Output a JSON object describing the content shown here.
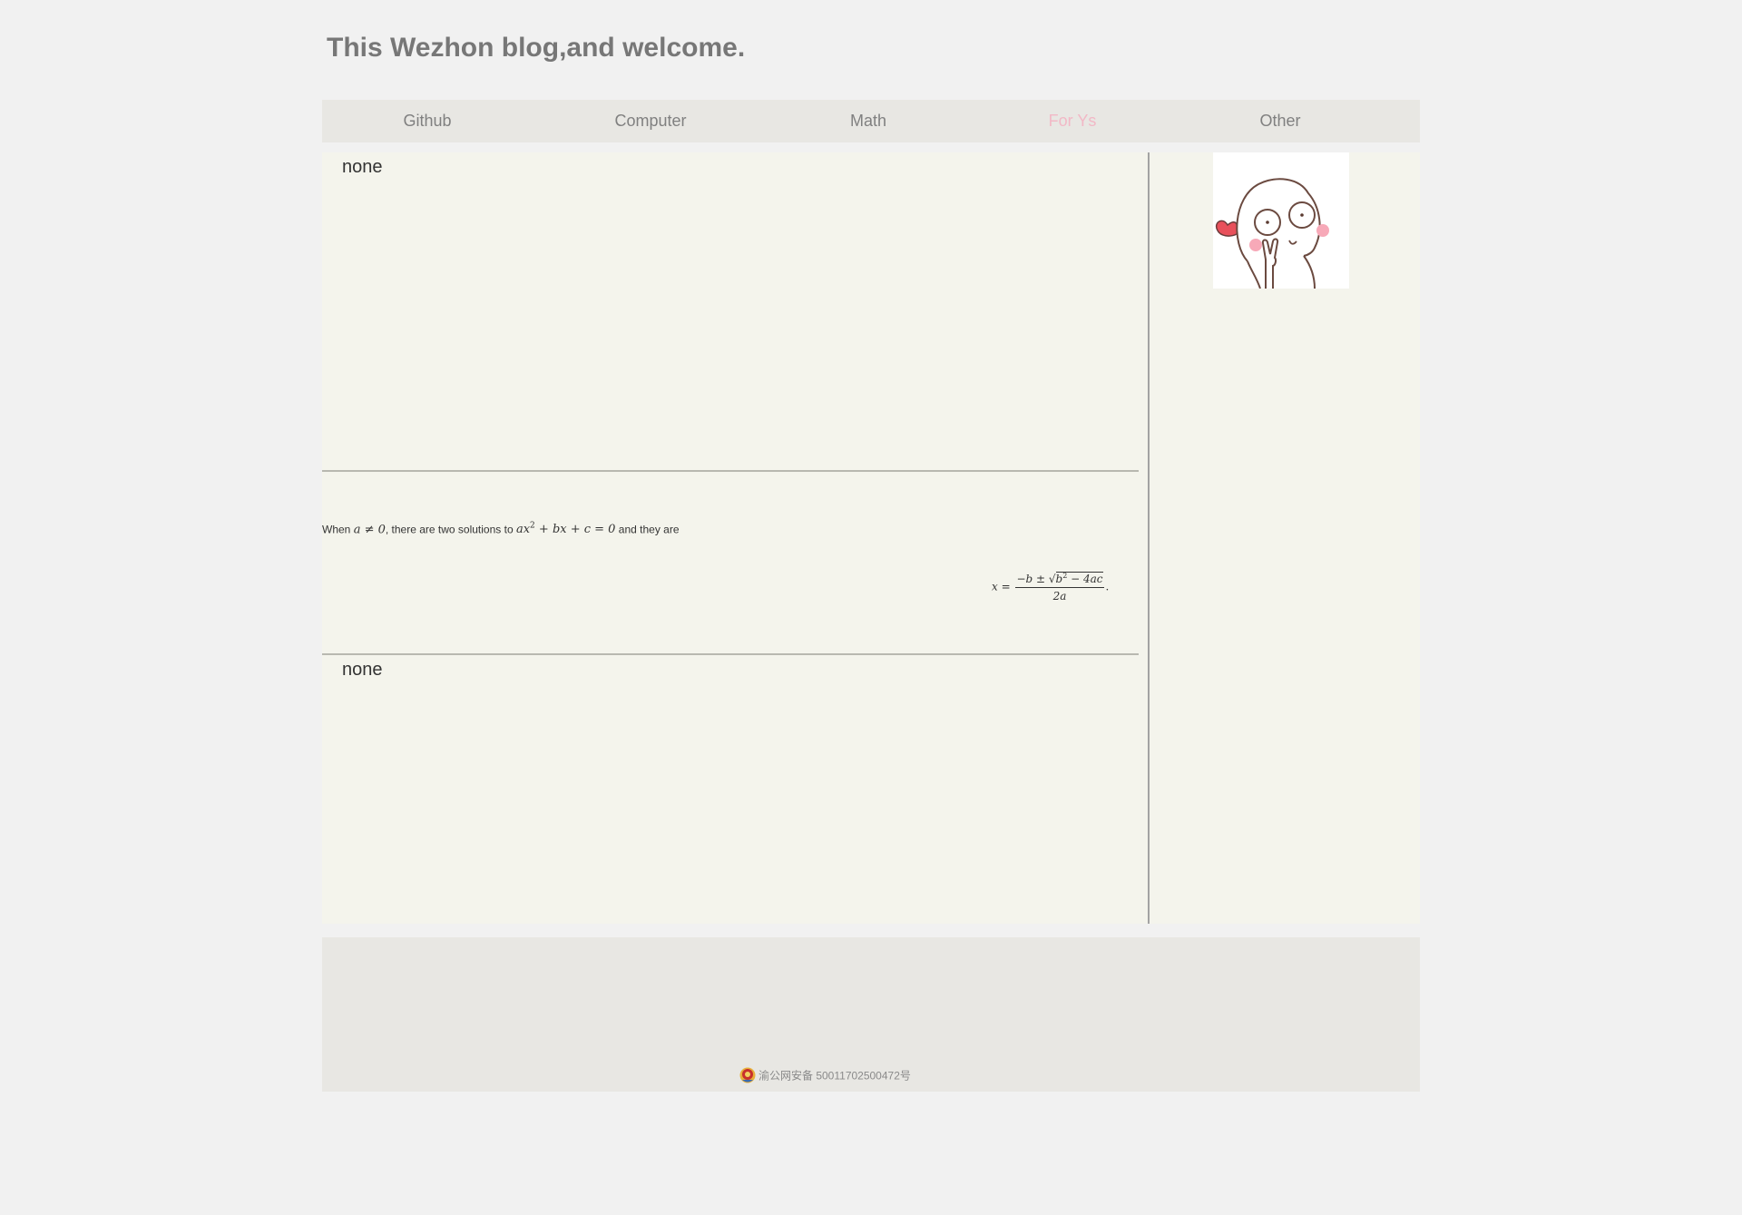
{
  "site": {
    "title": "This Wezhon blog,and welcome."
  },
  "nav": {
    "items": [
      {
        "label": "Github",
        "active": false
      },
      {
        "label": "Computer",
        "active": false
      },
      {
        "label": "Math",
        "active": false
      },
      {
        "label": "For Ys",
        "active": true
      },
      {
        "label": "Other",
        "active": false
      }
    ],
    "active_color": "#f2b8c6"
  },
  "main": {
    "block1_title": "none",
    "math_intro": {
      "prefix": "When ",
      "cond": "a ≠ 0",
      "mid": ", there are two solutions to ",
      "eq_a": "ax",
      "eq_sup": "2",
      "eq_rest": " + bx + c = 0",
      "suffix": " and they are"
    },
    "formula": {
      "lhs": "x = ",
      "num_pre": "−b ± ",
      "sqrt_sign": "√",
      "radicand_b": "b",
      "radicand_sup": "2",
      "radicand_rest": " − 4ac",
      "den": "2a",
      "end": "."
    },
    "block2_title": "none"
  },
  "sidebar": {
    "avatar_icon": "cartoon-peace-sign-heart"
  },
  "footer": {
    "beian_icon": "police-badge-icon",
    "beian_text": "渝公网安备 50011702500472号"
  }
}
